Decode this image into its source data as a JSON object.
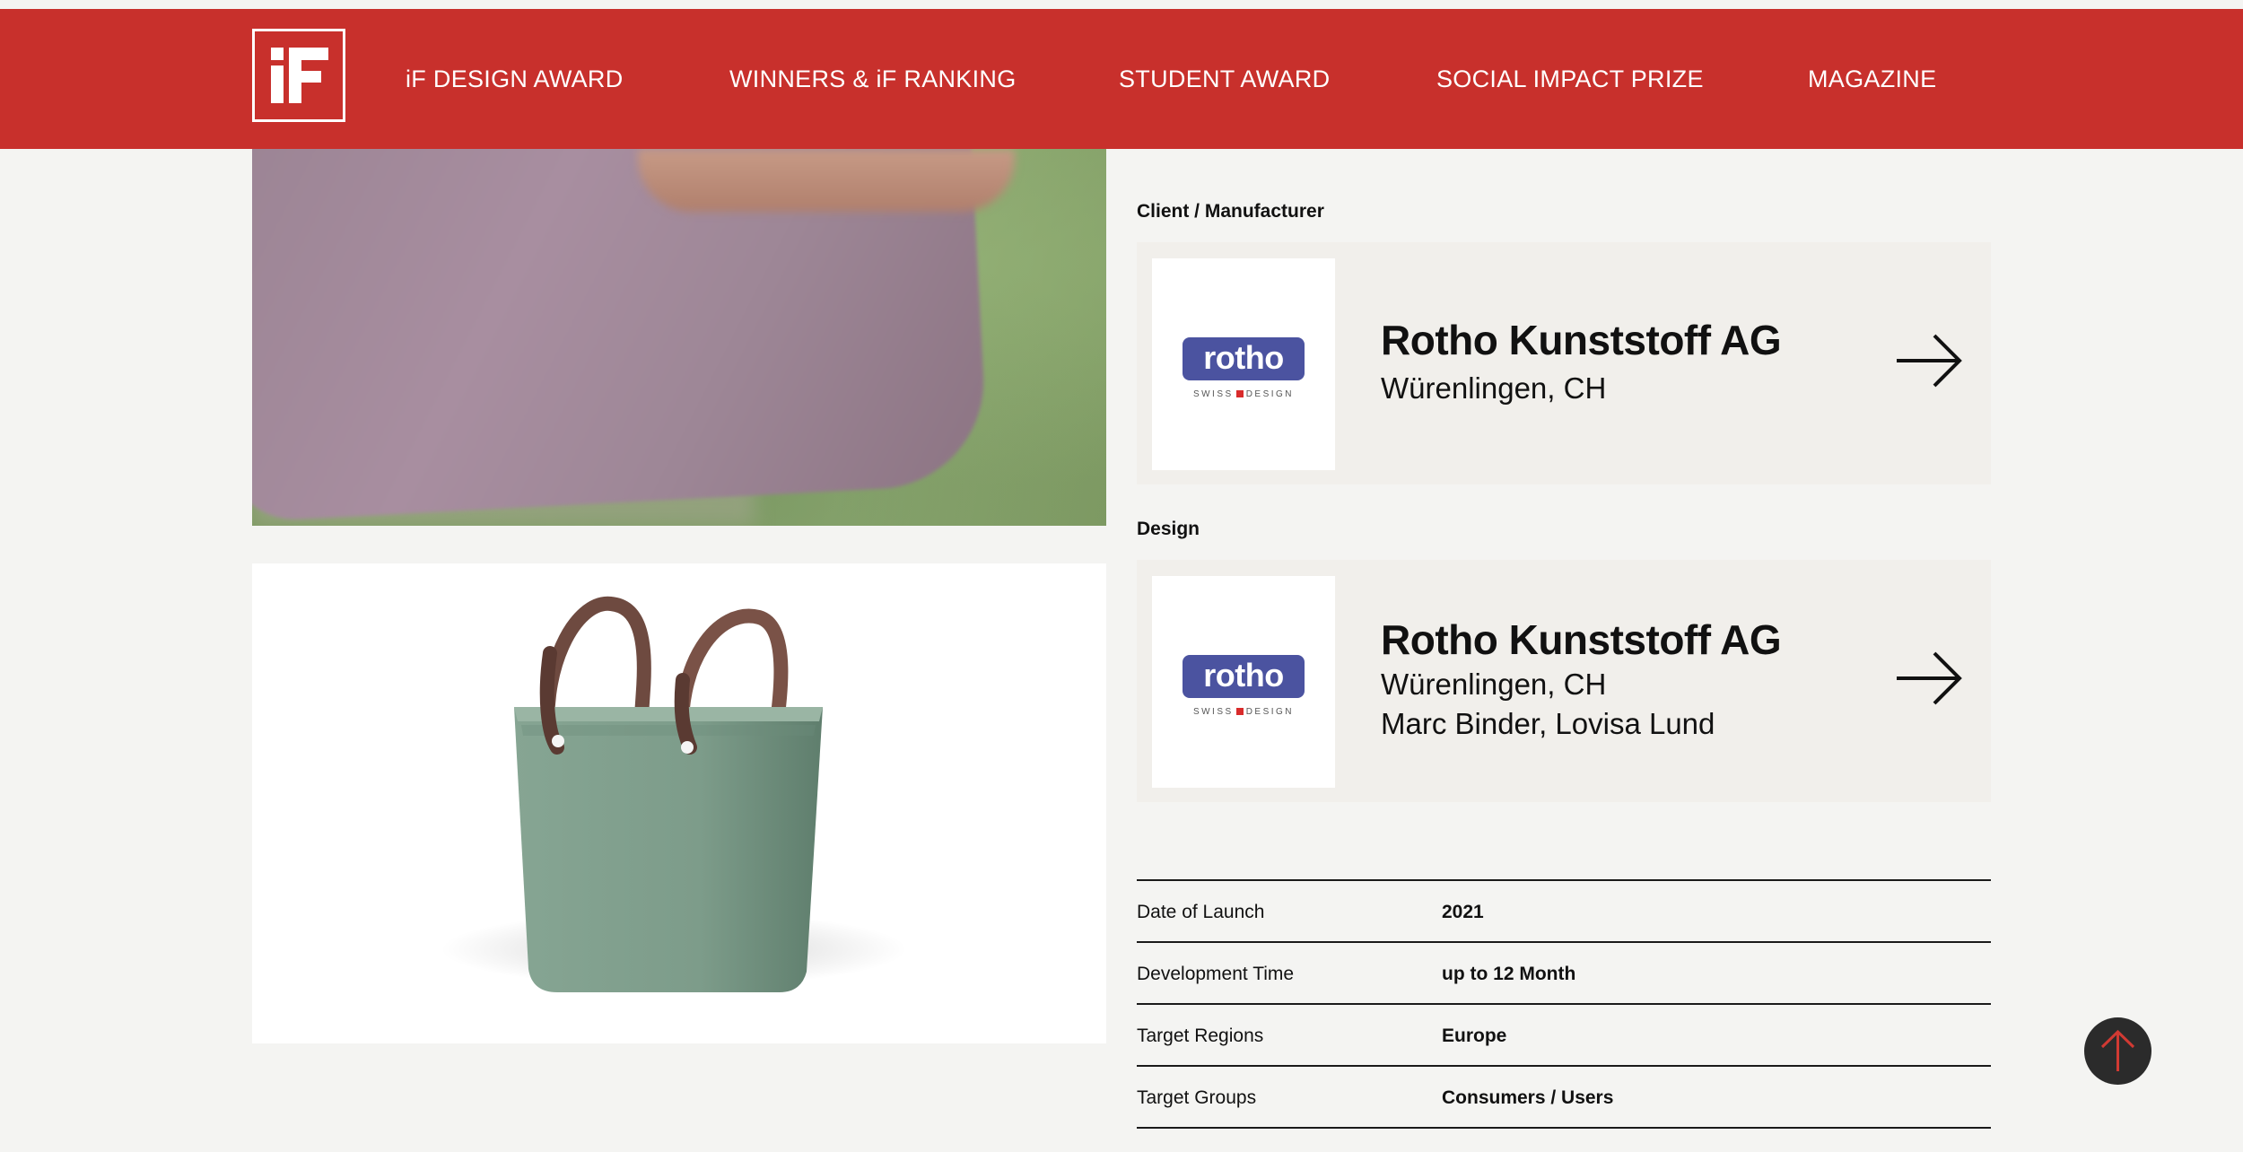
{
  "brand": {
    "primary": "#c8302c",
    "logo_icon": "if-logo-icon"
  },
  "nav": [
    {
      "label": "iF DESIGN AWARD"
    },
    {
      "label": "WINNERS & iF RANKING"
    },
    {
      "label": "STUDENT AWARD"
    },
    {
      "label": "SOCIAL IMPACT PRIZE"
    },
    {
      "label": "MAGAZINE"
    }
  ],
  "client": {
    "section_label": "Client / Manufacturer",
    "logo_text": "rotho",
    "logo_sub": "SWISS DESIGN",
    "name": "Rotho Kunststoff AG",
    "location": "Würenlingen, CH",
    "arrow_icon": "arrow-right-icon"
  },
  "design": {
    "section_label": "Design",
    "logo_text": "rotho",
    "logo_sub": "SWISS DESIGN",
    "name": "Rotho Kunststoff AG",
    "location": "Würenlingen, CH",
    "designers": "Marc Binder, Lovisa Lund",
    "arrow_icon": "arrow-right-icon"
  },
  "details": [
    {
      "label": "Date of Launch",
      "value": "2021"
    },
    {
      "label": "Development Time",
      "value": "up to 12 Month"
    },
    {
      "label": "Target Regions",
      "value": "Europe"
    },
    {
      "label": "Target Groups",
      "value": "Consumers / Users"
    }
  ],
  "scroll_top_icon": "arrow-up-icon"
}
